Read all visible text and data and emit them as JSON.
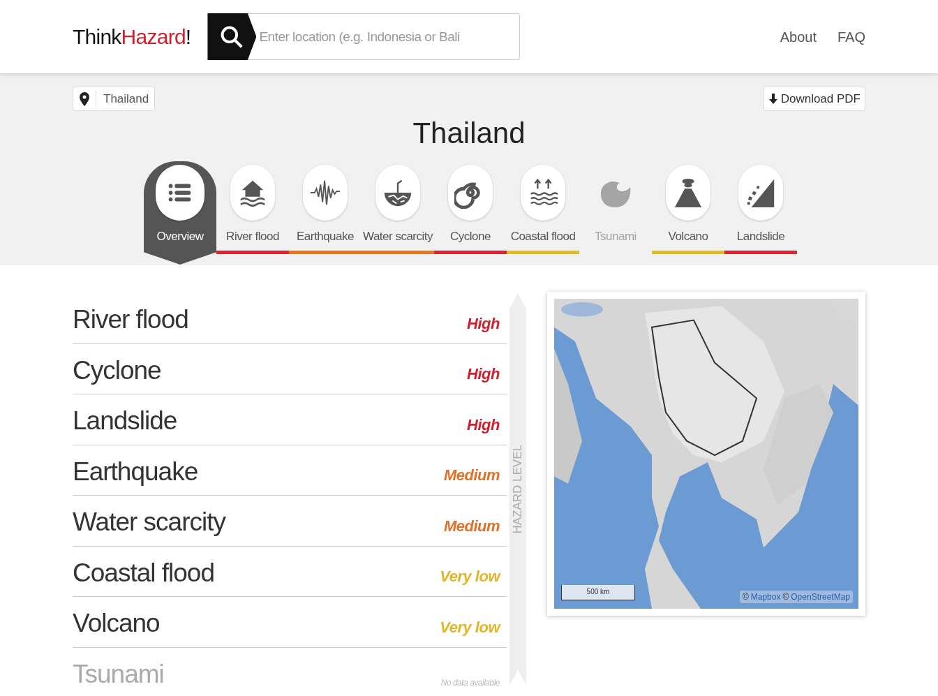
{
  "header": {
    "logo": {
      "plain": "Think",
      "accent": "Hazard",
      "mark": "!"
    },
    "search": {
      "placeholder": "Enter location (e.g. Indonesia or Bali"
    },
    "nav": [
      "About",
      "FAQ"
    ]
  },
  "breadcrumb": {
    "label": "Thailand"
  },
  "download": {
    "label": "Download PDF"
  },
  "title": "Thailand",
  "tabs": [
    {
      "label": "Overview",
      "selected": true,
      "disabled": false
    },
    {
      "label": "River flood",
      "selected": false,
      "disabled": false,
      "color": "#d92632"
    },
    {
      "label": "Earthquake",
      "selected": false,
      "disabled": false,
      "color": "#e07a2b"
    },
    {
      "label": "Water scarcity",
      "selected": false,
      "disabled": false,
      "color": "#e07a2b"
    },
    {
      "label": "Cyclone",
      "selected": false,
      "disabled": false,
      "color": "#d92632"
    },
    {
      "label": "Coastal flood",
      "selected": false,
      "disabled": false,
      "color": "#e0bb2b"
    },
    {
      "label": "Tsunami",
      "selected": false,
      "disabled": true
    },
    {
      "label": "Volcano",
      "selected": false,
      "disabled": false,
      "color": "#e0bb2b"
    },
    {
      "label": "Landslide",
      "selected": false,
      "disabled": false,
      "color": "#d92632"
    }
  ],
  "hazards": [
    {
      "name": "River flood",
      "level": "High",
      "kind": "rated",
      "color": "#d11f2e"
    },
    {
      "name": "Cyclone",
      "level": "High",
      "kind": "rated",
      "color": "#d11f2e"
    },
    {
      "name": "Landslide",
      "level": "High",
      "kind": "rated",
      "color": "#d11f2e"
    },
    {
      "name": "Earthquake",
      "level": "Medium",
      "kind": "rated",
      "color": "#df7126"
    },
    {
      "name": "Water scarcity",
      "level": "Medium",
      "kind": "rated",
      "color": "#df7126"
    },
    {
      "name": "Coastal flood",
      "level": "Very low",
      "kind": "rated",
      "color": "#e3b526"
    },
    {
      "name": "Volcano",
      "level": "Very low",
      "kind": "rated",
      "color": "#e3b526"
    },
    {
      "name": "Tsunami",
      "level": "No data available",
      "kind": "no_data"
    }
  ],
  "level_axis": "HAZARD LEVEL",
  "map": {
    "kind": "picture",
    "scale": "500 km",
    "attribution": [
      {
        "kind": "text",
        "text": "©"
      },
      {
        "kind": "link",
        "text": "Mapbox"
      },
      {
        "kind": "text",
        "text": "©"
      },
      {
        "kind": "link",
        "text": "OpenStreetMap"
      }
    ]
  }
}
